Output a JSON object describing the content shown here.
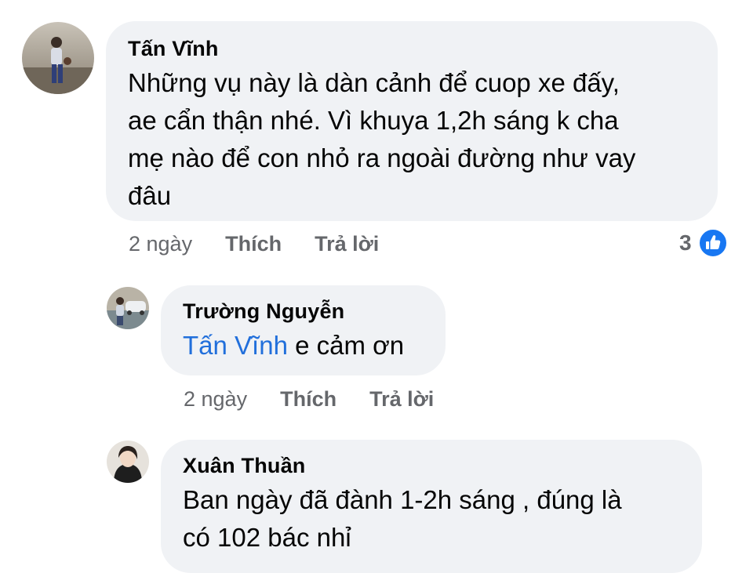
{
  "comments": [
    {
      "author": "Tấn Vĩnh",
      "text_lines": [
        "Những vụ này là dàn cảnh để cuop xe đấy,",
        "ae cẩn thận nhé. Vì khuya 1,2h sáng k cha",
        "mẹ nào để con nhỏ ra ngoài đường như vay",
        "đâu"
      ],
      "time": "2 ngày",
      "like_label": "Thích",
      "reply_label": "Trả lời",
      "reaction_count": "3",
      "reaction_icon": "like-icon"
    },
    {
      "author": "Trường Nguyễn",
      "mention": "Tấn Vĩnh",
      "text": " e cảm ơn",
      "time": "2 ngày",
      "like_label": "Thích",
      "reply_label": "Trả lời"
    },
    {
      "author": "Xuân Thuần",
      "text_lines": [
        "Ban ngày đã đành 1-2h sáng , đúng là",
        "có 102 bác nhỉ"
      ]
    }
  ],
  "colors": {
    "bubble": "#f0f2f5",
    "mention": "#216fdb",
    "meta": "#65676b",
    "like_badge": "#1877f2"
  }
}
